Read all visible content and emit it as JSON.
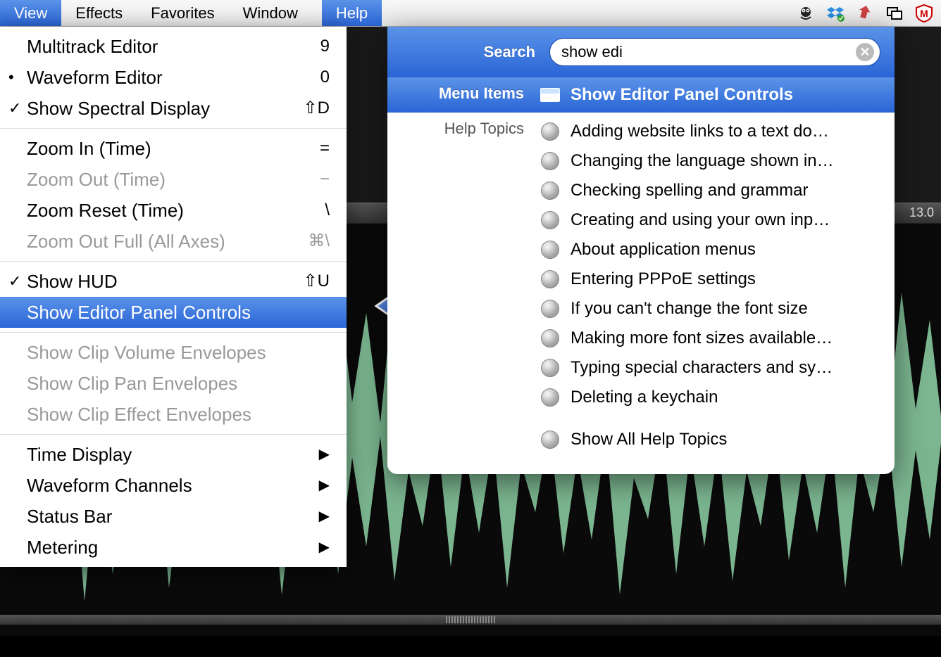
{
  "menubar": {
    "items": [
      "View",
      "Effects",
      "Favorites",
      "Window",
      "Help"
    ]
  },
  "view_menu": {
    "groups": [
      [
        {
          "mark": "",
          "label": "Multitrack Editor",
          "shortcut": "9",
          "enabled": true
        },
        {
          "mark": "•",
          "label": "Waveform Editor",
          "shortcut": "0",
          "enabled": true
        },
        {
          "mark": "✓",
          "label": "Show Spectral Display",
          "shortcut": "⇧D",
          "enabled": true
        }
      ],
      [
        {
          "mark": "",
          "label": "Zoom In (Time)",
          "shortcut": "=",
          "enabled": true
        },
        {
          "mark": "",
          "label": "Zoom Out (Time)",
          "shortcut": "−",
          "enabled": false
        },
        {
          "mark": "",
          "label": "Zoom Reset (Time)",
          "shortcut": "\\",
          "enabled": true
        },
        {
          "mark": "",
          "label": "Zoom Out Full (All Axes)",
          "shortcut": "⌘\\",
          "enabled": false
        }
      ],
      [
        {
          "mark": "✓",
          "label": "Show HUD",
          "shortcut": "⇧U",
          "enabled": true
        },
        {
          "mark": "",
          "label": "Show Editor Panel Controls",
          "shortcut": "",
          "enabled": true,
          "highlighted": true
        }
      ],
      [
        {
          "mark": "",
          "label": "Show Clip Volume Envelopes",
          "shortcut": "",
          "enabled": false
        },
        {
          "mark": "",
          "label": "Show Clip Pan Envelopes",
          "shortcut": "",
          "enabled": false
        },
        {
          "mark": "",
          "label": "Show Clip Effect Envelopes",
          "shortcut": "",
          "enabled": false
        }
      ],
      [
        {
          "mark": "",
          "label": "Time Display",
          "shortcut": "",
          "enabled": true,
          "submenu": true
        },
        {
          "mark": "",
          "label": "Waveform Channels",
          "shortcut": "",
          "enabled": true,
          "submenu": true
        },
        {
          "mark": "",
          "label": "Status Bar",
          "shortcut": "",
          "enabled": true,
          "submenu": true
        },
        {
          "mark": "",
          "label": "Metering",
          "shortcut": "",
          "enabled": true,
          "submenu": true
        }
      ]
    ]
  },
  "help": {
    "search_label": "Search",
    "search_value": "show edi",
    "menu_items_label": "Menu Items",
    "help_topics_label": "Help Topics",
    "menu_result": "Show Editor Panel Controls",
    "topics": [
      "Adding website links to a text do…",
      "Changing the language shown in…",
      "Checking spelling and grammar",
      "Creating and using your own inp…",
      "About application menus",
      "Entering PPPoE settings",
      "If you can't change the font size",
      "Making more font sizes available…",
      "Typing special characters and sy…",
      "Deleting a keychain"
    ],
    "show_all": "Show All Help Topics"
  },
  "ruler": {
    "mark": "13.0"
  }
}
